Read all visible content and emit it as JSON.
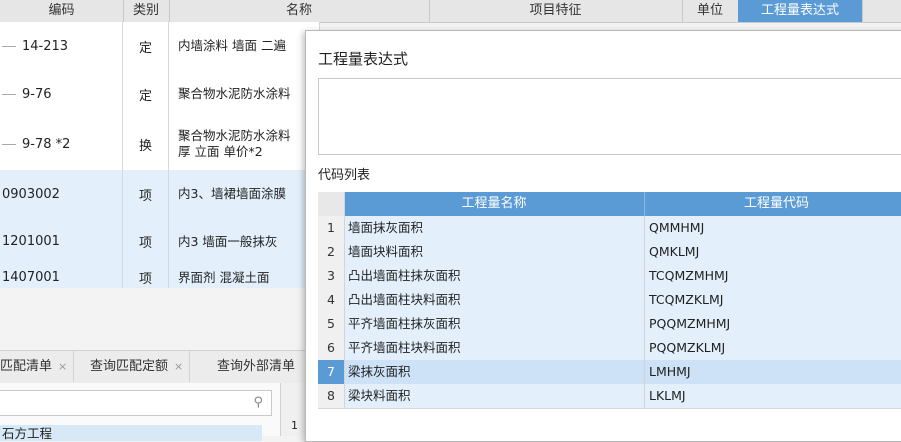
{
  "grid": {
    "headers": [
      "编码",
      "类别",
      "名称",
      "项目特征",
      "单位",
      "工程量表达式"
    ],
    "rows": [
      {
        "code": "14-213",
        "type": "定",
        "name": "内墙涂料 墙面 二遍",
        "indent": true
      },
      {
        "code": "9-76",
        "type": "定",
        "name": "聚合物水泥防水涂料",
        "indent": true
      },
      {
        "code": "9-78 *2",
        "type": "换",
        "name": "聚合物水泥防水涂料 厚 立面 单价*2",
        "name_line1": "聚合物水泥防水涂料",
        "name_line2": "厚 立面 单价*2",
        "indent": true
      },
      {
        "code": "0903002",
        "type": "项",
        "name": "内3、墙裙墙面涂膜",
        "indent": false
      },
      {
        "code": "1201001",
        "type": "项",
        "name": "内3 墙面一般抹灰",
        "indent": false
      },
      {
        "code": "1407001",
        "type": "项",
        "name": "界面剂 混凝土面",
        "indent": false
      }
    ]
  },
  "bottom_tabs": [
    {
      "label": "匹配清单",
      "close": "×"
    },
    {
      "label": "查询匹配定额",
      "close": "×"
    },
    {
      "label": "查询外部清单",
      "close": ""
    }
  ],
  "search": {
    "icon": "search-icon",
    "value": ""
  },
  "bottom_list": {
    "row_num": "1",
    "item": "石方工程"
  },
  "dialog": {
    "title": "工程量表达式",
    "expression": "",
    "code_list_label": "代码列表",
    "table_headers": {
      "name": "工程量名称",
      "code": "工程量代码"
    },
    "rows": [
      {
        "num": "1",
        "name": "墙面抹灰面积",
        "code": "QMMHMJ"
      },
      {
        "num": "2",
        "name": "墙面块料面积",
        "code": "QMKLMJ"
      },
      {
        "num": "3",
        "name": "凸出墙面柱抹灰面积",
        "code": "TCQMZMHMJ"
      },
      {
        "num": "4",
        "name": "凸出墙面柱块料面积",
        "code": "TCQMZKLMJ"
      },
      {
        "num": "5",
        "name": "平齐墙面柱抹灰面积",
        "code": "PQQMZMHMJ"
      },
      {
        "num": "6",
        "name": "平齐墙面柱块料面积",
        "code": "PQQMZKLMJ"
      },
      {
        "num": "7",
        "name": "梁抹灰面积",
        "code": "LMHMJ",
        "selected": true
      },
      {
        "num": "8",
        "name": "梁块料面积",
        "code": "LKLMJ"
      }
    ]
  },
  "colors": {
    "accent": "#5b9bd5",
    "selected_row": "#cde2f6",
    "item_row": "#e3f0fb"
  }
}
